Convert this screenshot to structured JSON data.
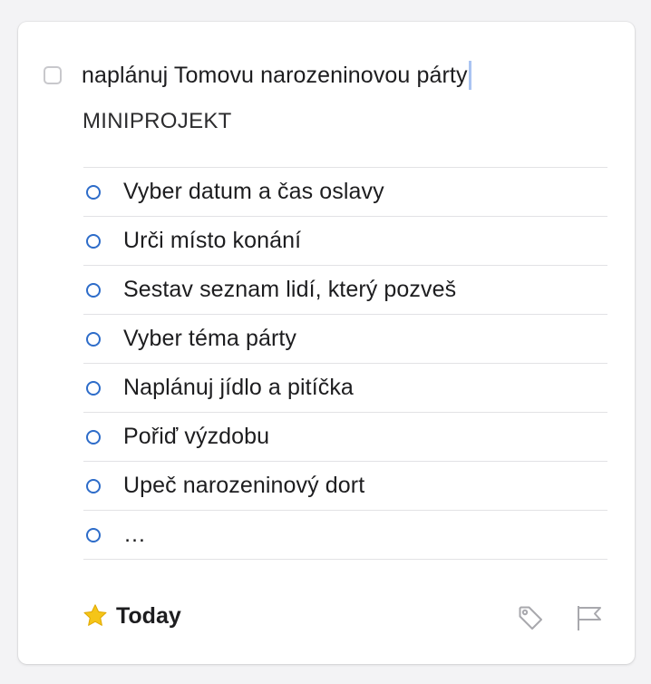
{
  "task": {
    "title": "naplánuj Tomovu narozeninovou párty",
    "notes": "MINIPROJEKT",
    "checklist": [
      {
        "label": "Vyber datum a čas oslavy"
      },
      {
        "label": "Urči místo konání"
      },
      {
        "label": "Sestav seznam lidí, který pozveš"
      },
      {
        "label": "Vyber téma párty"
      },
      {
        "label": "Naplánuj jídlo a pitíčka"
      },
      {
        "label": "Pořiď výzdobu"
      },
      {
        "label": "Upeč narozeninový dort"
      },
      {
        "label": "…"
      }
    ],
    "when": {
      "label": "Today",
      "icon": "star-icon"
    },
    "tools": [
      {
        "icon": "tag-icon"
      },
      {
        "icon": "flag-icon"
      }
    ]
  },
  "colors": {
    "accent": "#2d6cc9",
    "star": "#f5c518",
    "caret": "#aac4f2",
    "muted_icon": "#a8a8ad"
  }
}
